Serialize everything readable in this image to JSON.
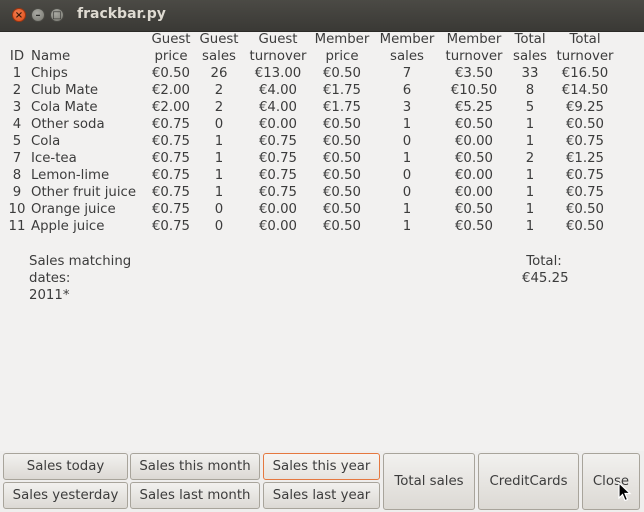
{
  "window": {
    "title": "frackbar.py"
  },
  "table": {
    "headers": [
      [
        "",
        "ID"
      ],
      [
        "",
        "Name"
      ],
      [
        "Guest",
        "price"
      ],
      [
        "Guest",
        "sales"
      ],
      [
        "Guest",
        "turnover"
      ],
      [
        "Member",
        "price"
      ],
      [
        "Member",
        "sales"
      ],
      [
        "Member",
        "turnover"
      ],
      [
        "Total",
        "sales"
      ],
      [
        "Total",
        "turnover"
      ]
    ],
    "rows": [
      [
        "1",
        "Chips",
        "€0.50",
        "26",
        "€13.00",
        "€0.50",
        "7",
        "€3.50",
        "33",
        "€16.50"
      ],
      [
        "2",
        "Club Mate",
        "€2.00",
        "2",
        "€4.00",
        "€1.75",
        "6",
        "€10.50",
        "8",
        "€14.50"
      ],
      [
        "3",
        "Cola Mate",
        "€2.00",
        "2",
        "€4.00",
        "€1.75",
        "3",
        "€5.25",
        "5",
        "€9.25"
      ],
      [
        "4",
        "Other soda",
        "€0.75",
        "0",
        "€0.00",
        "€0.50",
        "1",
        "€0.50",
        "1",
        "€0.50"
      ],
      [
        "5",
        "Cola",
        "€0.75",
        "1",
        "€0.75",
        "€0.50",
        "0",
        "€0.00",
        "1",
        "€0.75"
      ],
      [
        "7",
        "Ice-tea",
        "€0.75",
        "1",
        "€0.75",
        "€0.50",
        "1",
        "€0.50",
        "2",
        "€1.25"
      ],
      [
        "8",
        "Lemon-lime",
        "€0.75",
        "1",
        "€0.75",
        "€0.50",
        "0",
        "€0.00",
        "1",
        "€0.75"
      ],
      [
        "9",
        "Other fruit juice",
        "€0.75",
        "1",
        "€0.75",
        "€0.50",
        "0",
        "€0.00",
        "1",
        "€0.75"
      ],
      [
        "10",
        "Orange juice",
        "€0.75",
        "0",
        "€0.00",
        "€0.50",
        "1",
        "€0.50",
        "1",
        "€0.50"
      ],
      [
        "11",
        "Apple juice",
        "€0.75",
        "0",
        "€0.00",
        "€0.50",
        "1",
        "€0.50",
        "1",
        "€0.50"
      ]
    ]
  },
  "summary": {
    "matching_line1": "Sales matching",
    "matching_line2": "dates:",
    "matching_value": "2011*",
    "total_label": "Total:",
    "total_value": "€45.25"
  },
  "buttons": {
    "sales_today": "Sales today",
    "sales_yesterday": "Sales yesterday",
    "sales_this_month": "Sales this month",
    "sales_last_month": "Sales last month",
    "sales_this_year": "Sales this year",
    "sales_last_year": "Sales last year",
    "total_sales": "Total sales",
    "creditcards": "CreditCards",
    "close": "Close"
  },
  "icons": {
    "close": "close-icon",
    "minimize": "minimize-icon",
    "maximize": "maximize-icon",
    "cursor": "mouse-pointer-icon"
  },
  "colors": {
    "titlebar": "#3c3b37",
    "background": "#f2f1f0",
    "active_button_border": "#e5783f",
    "close_button": "#df4b15"
  }
}
